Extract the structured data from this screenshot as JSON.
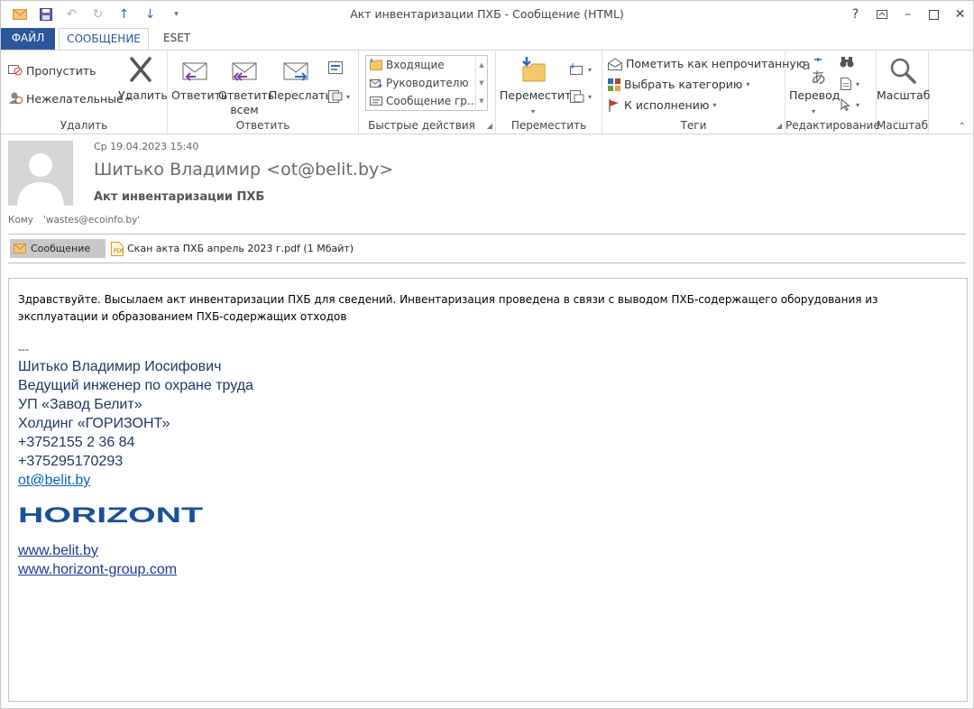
{
  "window": {
    "title": "Акт инвентаризации ПХБ - Сообщение (HTML)"
  },
  "tabs": {
    "file": "ФАЙЛ",
    "message": "СООБЩЕНИЕ",
    "eset": "ESET"
  },
  "ribbon": {
    "delete_group": {
      "label": "Удалить",
      "ignore": "Пропустить",
      "junk": "Нежелательные",
      "delete": "Удалить"
    },
    "respond_group": {
      "label": "Ответить",
      "reply": "Ответить",
      "reply_all_1": "Ответить",
      "reply_all_2": "всем",
      "forward": "Переслать"
    },
    "quicksteps_group": {
      "label": "Быстрые действия",
      "items": [
        "Входящие",
        "Руководителю",
        "Сообщение гр..."
      ]
    },
    "move_group": {
      "label": "Переместить",
      "move": "Переместить"
    },
    "tags_group": {
      "label": "Теги",
      "mark_unread": "Пометить как непрочитанную",
      "categorize": "Выбрать категорию",
      "follow_up": "К исполнению"
    },
    "editing_group": {
      "label": "Редактирование",
      "translate": "Перевод"
    },
    "zoom_group": {
      "label": "Масштаб",
      "zoom": "Масштаб"
    }
  },
  "header": {
    "date": "Ср 19.04.2023 15:40",
    "from": "Шитько Владимир <ot@belit.by>",
    "subject": "Акт инвентаризации ПХБ",
    "to_label": "Кому",
    "to_value": "'wastes@ecoinfo.by'",
    "attachments": {
      "message_tab": "Сообщение",
      "file": "Скан акта ПХБ апрель 2023 г.pdf (1 Мбайт)"
    }
  },
  "body": {
    "intro": "Здравствуйте. Высылаем акт инвентаризации ПХБ для сведений. Инвентаризация проведена в связи с выводом ПХБ-содержащего оборудования из эксплуатации и образованием ПХБ-содержащих отходов",
    "signature": {
      "dash": "---",
      "name": "Шитько Владимир Иосифович",
      "position": "Ведущий инженер по охране труда",
      "company": "УП «Завод Белит»",
      "holding": "Холдинг «ГОРИЗОНТ»",
      "phone1": "+3752155 2 36 84",
      "phone2": "+375295170293",
      "email": "ot@belit.by",
      "logo_text": "HORIZONT",
      "link1": "www.belit.by",
      "link2": "www.horizont-group.com"
    }
  },
  "colors": {
    "brand_blue": "#2b579a",
    "signature_blue": "#1f3864",
    "logo_blue": "#1a4f9c"
  }
}
